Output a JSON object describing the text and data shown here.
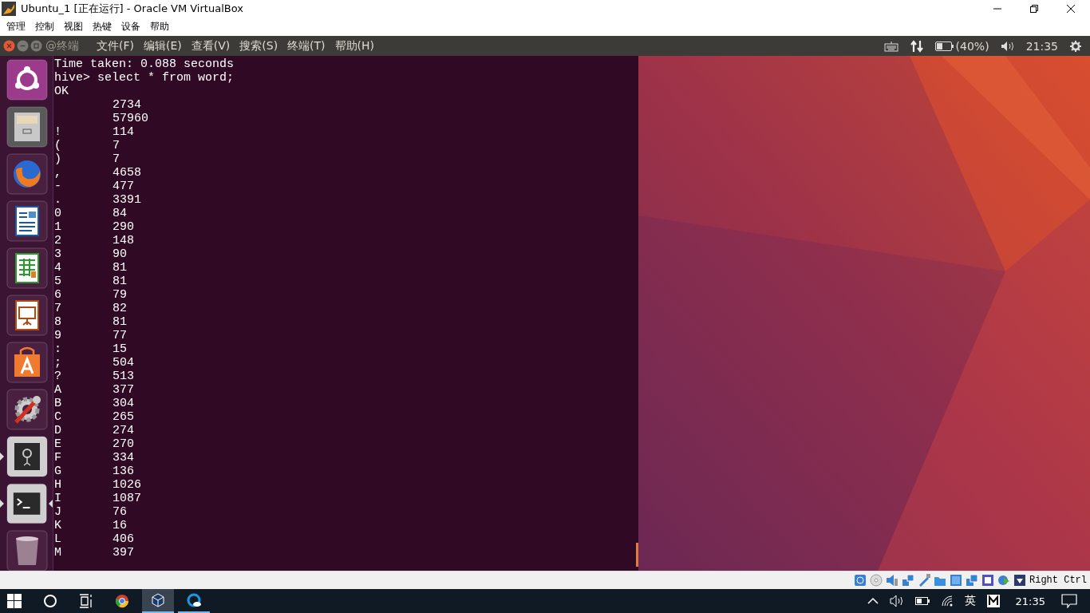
{
  "window": {
    "title": "Ubuntu_1 [正在运行] - Oracle VM VirtualBox"
  },
  "vbox_menu": [
    "管理",
    "控制",
    "视图",
    "热键",
    "设备",
    "帮助"
  ],
  "guest_panel": {
    "app_title": "@终端",
    "menu": [
      "文件(F)",
      "编辑(E)",
      "查看(V)",
      "搜索(S)",
      "终端(T)",
      "帮助(H)"
    ],
    "battery": "(40%)",
    "clock": "21:35"
  },
  "launcher": [
    {
      "running": false,
      "focused": false
    },
    {
      "running": false,
      "focused": false
    },
    {
      "running": false,
      "focused": false
    },
    {
      "running": false,
      "focused": false
    },
    {
      "running": false,
      "focused": false
    },
    {
      "running": false,
      "focused": false
    },
    {
      "running": false,
      "focused": false
    },
    {
      "running": false,
      "focused": false
    },
    {
      "running": true,
      "focused": false
    },
    {
      "running": true,
      "focused": true
    },
    {
      "running": false,
      "focused": false
    }
  ],
  "terminal": {
    "lines": [
      "Time taken: 0.088 seconds",
      "hive> select * from word;",
      "OK"
    ],
    "rows": [
      {
        "value": "2734"
      },
      {
        "value": "57960"
      },
      {
        "key": "!",
        "value": "114"
      },
      {
        "key": "(",
        "value": "7"
      },
      {
        "key": ")",
        "value": "7"
      },
      {
        "key": ",",
        "value": "4658"
      },
      {
        "key": "-",
        "value": "477"
      },
      {
        "key": ".",
        "value": "3391"
      },
      {
        "key": "0",
        "value": "84"
      },
      {
        "key": "1",
        "value": "290"
      },
      {
        "key": "2",
        "value": "148"
      },
      {
        "key": "3",
        "value": "90"
      },
      {
        "key": "4",
        "value": "81"
      },
      {
        "key": "5",
        "value": "81"
      },
      {
        "key": "6",
        "value": "79"
      },
      {
        "key": "7",
        "value": "82"
      },
      {
        "key": "8",
        "value": "81"
      },
      {
        "key": "9",
        "value": "77"
      },
      {
        "key": ":",
        "value": "15"
      },
      {
        "key": ";",
        "value": "504"
      },
      {
        "key": "?",
        "value": "513"
      },
      {
        "key": "A",
        "value": "377"
      },
      {
        "key": "B",
        "value": "304"
      },
      {
        "key": "C",
        "value": "265"
      },
      {
        "key": "D",
        "value": "274"
      },
      {
        "key": "E",
        "value": "270"
      },
      {
        "key": "F",
        "value": "334"
      },
      {
        "key": "G",
        "value": "136"
      },
      {
        "key": "H",
        "value": "1026"
      },
      {
        "key": "I",
        "value": "1087"
      },
      {
        "key": "J",
        "value": "76"
      },
      {
        "key": "K",
        "value": "16"
      },
      {
        "key": "L",
        "value": "406"
      },
      {
        "key": "M",
        "value": "397"
      }
    ]
  },
  "vbox_status": {
    "host_key": "Right Ctrl"
  },
  "taskbar": {
    "apps": [
      {
        "selected": false,
        "running": false
      },
      {
        "selected": true,
        "running": true
      },
      {
        "selected": false,
        "running": true
      }
    ],
    "ime": "英",
    "clock": "21:35"
  }
}
